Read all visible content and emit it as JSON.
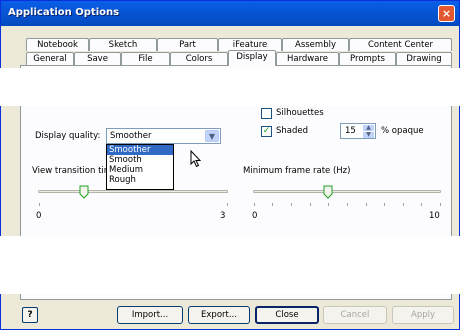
{
  "window": {
    "title": "Application Options",
    "close_glyph": "×"
  },
  "tabs_row1": [
    "Notebook",
    "Sketch",
    "Part",
    "iFeature",
    "Assembly",
    "Content Center"
  ],
  "tabs_row2": [
    "General",
    "Save",
    "File",
    "Colors",
    "Display",
    "Hardware",
    "Prompts",
    "Drawing"
  ],
  "active_tab": "Display",
  "display_quality": {
    "label": "Display quality:",
    "value": "Smoother",
    "options": [
      "Smoother",
      "Smooth",
      "Medium",
      "Rough"
    ],
    "highlighted": "Smoother"
  },
  "silhouettes": {
    "label": "Silhouettes",
    "checked": false
  },
  "shaded": {
    "label": "Shaded",
    "checked": true,
    "opacity_value": "15",
    "opacity_unit": "% opaque"
  },
  "view_transition": {
    "label": "View transition tim",
    "min": "0",
    "max": "3",
    "value": 1
  },
  "min_frame_rate": {
    "label": "Minimum frame rate (Hz)",
    "min": "0",
    "max": "10",
    "value": 4
  },
  "buttons": {
    "help": "?",
    "import": "Import...",
    "export": "Export...",
    "close": "Close",
    "cancel": "Cancel",
    "apply": "Apply"
  }
}
